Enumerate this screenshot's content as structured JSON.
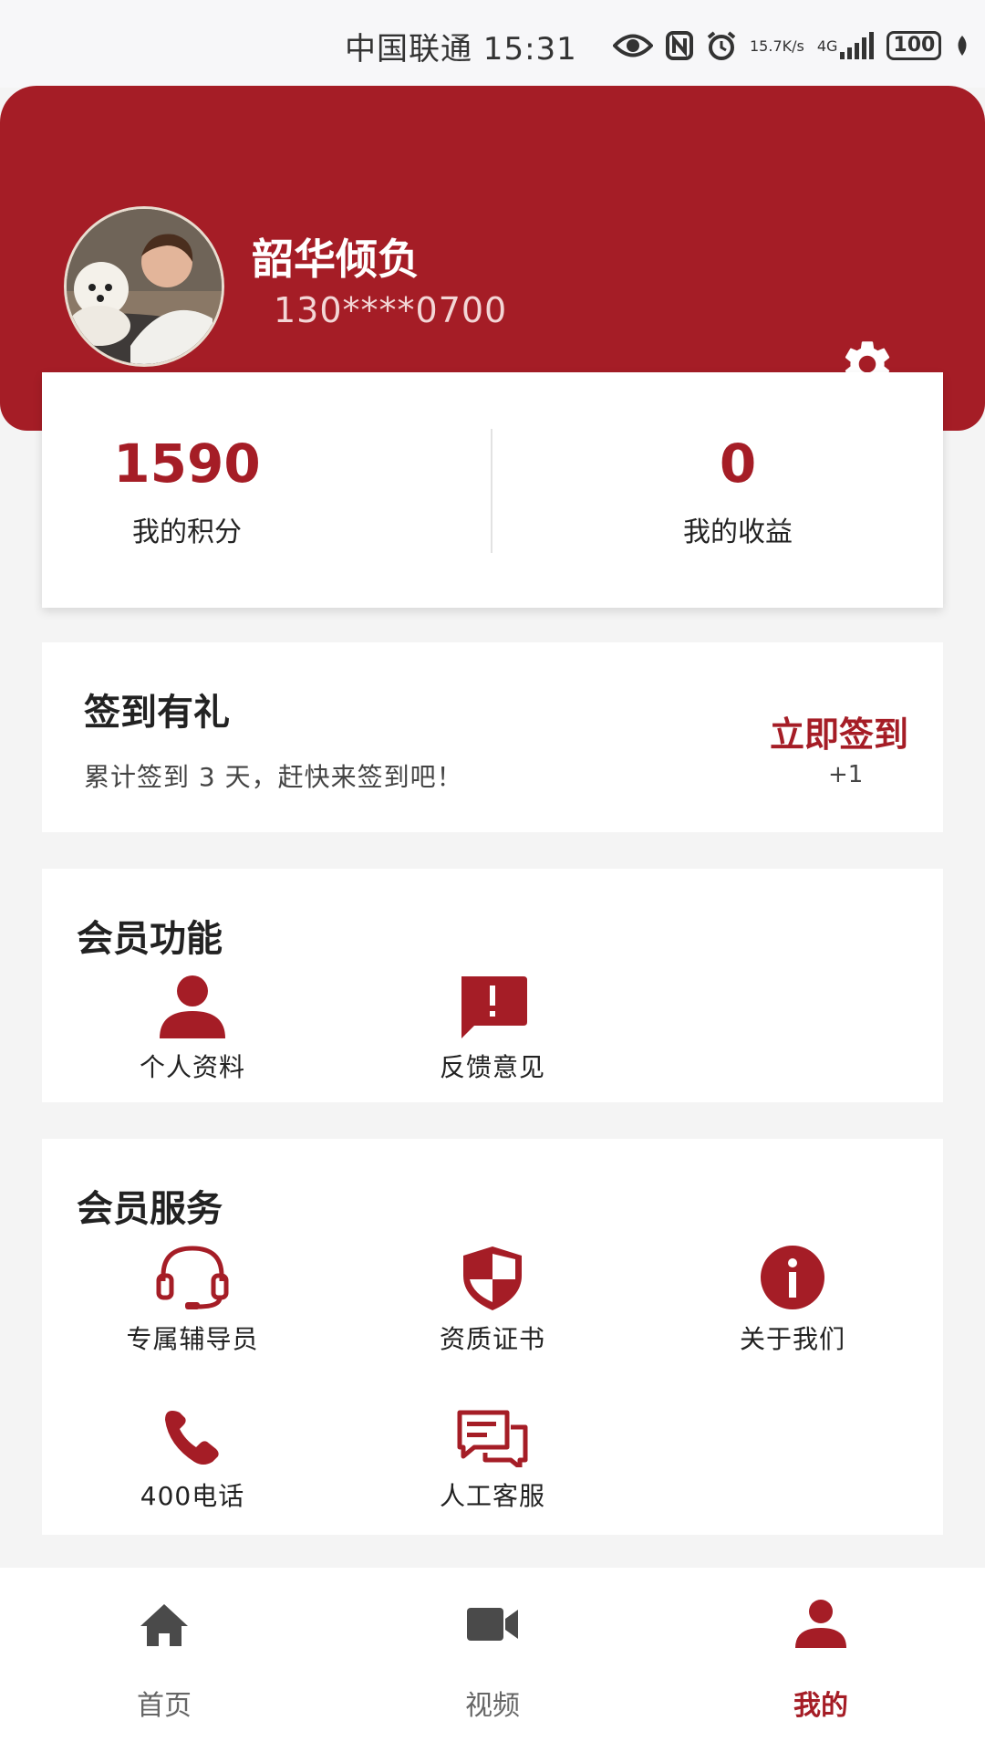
{
  "status_bar": {
    "carrier_time": "中国联通 15:31",
    "net_speed_value": "15.7",
    "net_speed_unit": "K/s",
    "network": "4G",
    "battery": "100"
  },
  "profile": {
    "name": "韶华倾负",
    "phone": "130****0700"
  },
  "stats": {
    "points_value": "1590",
    "points_label": "我的积分",
    "earnings_value": "0",
    "earnings_label": "我的收益"
  },
  "signin": {
    "title": "签到有礼",
    "description": "累计签到 3 天，赶快来签到吧！",
    "button_label": "立即签到",
    "reward": "+1"
  },
  "member_features": {
    "title": "会员功能",
    "items": [
      {
        "label": "个人资料",
        "icon": "person-icon"
      },
      {
        "label": "反馈意见",
        "icon": "feedback-icon"
      }
    ]
  },
  "member_services": {
    "title": "会员服务",
    "items": [
      {
        "label": "专属辅导员",
        "icon": "headset-icon"
      },
      {
        "label": "资质证书",
        "icon": "shield-icon"
      },
      {
        "label": "关于我们",
        "icon": "info-icon"
      },
      {
        "label": "400电话",
        "icon": "phone-icon"
      },
      {
        "label": "人工客服",
        "icon": "chat-icon"
      }
    ]
  },
  "bottom_nav": {
    "items": [
      {
        "label": "首页",
        "icon": "home-icon",
        "active": false
      },
      {
        "label": "视频",
        "icon": "video-icon",
        "active": false
      },
      {
        "label": "我的",
        "icon": "person-icon",
        "active": true
      }
    ]
  },
  "colors": {
    "accent": "#a51d26",
    "background": "#f4f4f4",
    "card": "#ffffff",
    "nav_inactive": "#4a4a4a"
  }
}
